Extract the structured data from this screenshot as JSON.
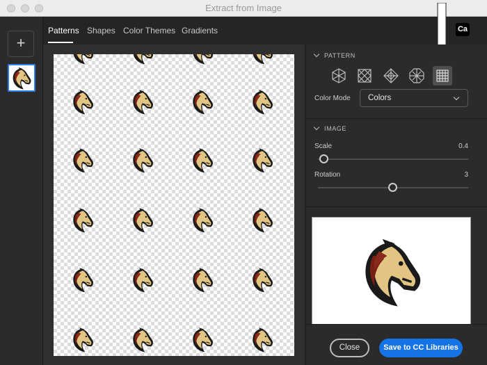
{
  "window": {
    "title": "Extract from Image"
  },
  "sidebar": {
    "add_label": "+"
  },
  "tabs": [
    {
      "label": "Patterns",
      "active": true
    },
    {
      "label": "Shapes"
    },
    {
      "label": "Color Themes"
    },
    {
      "label": "Gradients"
    }
  ],
  "app_badge": "Ca",
  "pattern": {
    "header": "PATTERN",
    "types": [
      "hexagon-pattern-icon",
      "diamond-grid-pattern-icon",
      "rhombus-pattern-icon",
      "octagon-pattern-icon",
      "square-grid-pattern-icon"
    ],
    "selected": "square-grid-pattern-icon",
    "color_mode_label": "Color Mode",
    "color_mode_value": "Colors"
  },
  "image": {
    "header": "IMAGE",
    "scale_label": "Scale",
    "scale_value": "0.4",
    "rotation_label": "Rotation",
    "rotation_value": "3"
  },
  "footer": {
    "close_label": "Close",
    "save_label": "Save to CC Libraries"
  },
  "colors": {
    "accent": "#1473e6",
    "horse_tan": "#e2c583",
    "horse_maroon": "#7a1f14"
  }
}
